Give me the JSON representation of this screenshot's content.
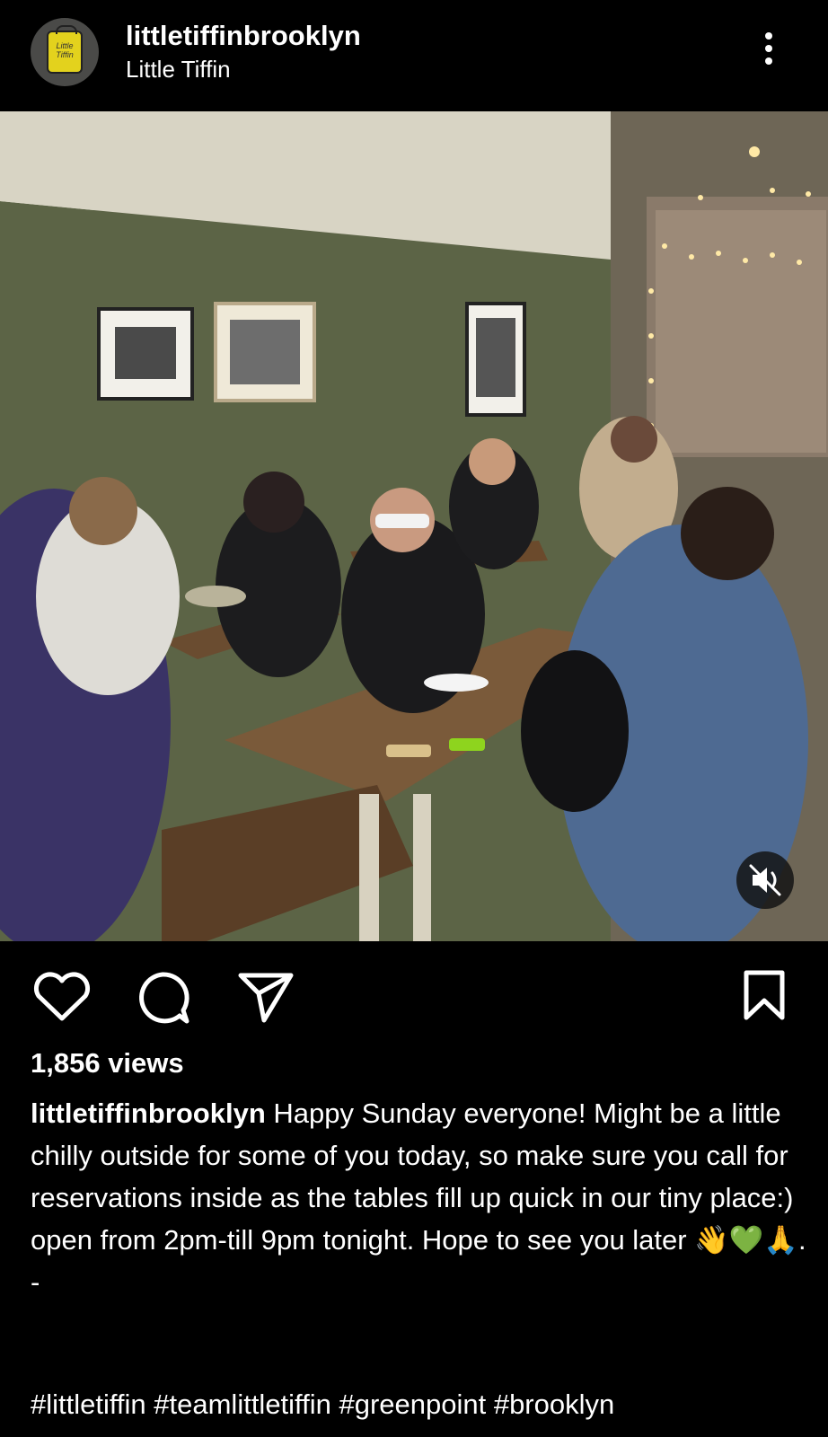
{
  "header": {
    "username": "littletiffinbrooklyn",
    "display_name": "Little Tiffin",
    "avatar_text": "Little Tiffin",
    "more_icon": "more-vertical-icon"
  },
  "media": {
    "type": "video",
    "mute_icon": "volume-muted-icon"
  },
  "actions": {
    "like_icon": "heart-icon",
    "comment_icon": "comment-icon",
    "share_icon": "send-icon",
    "save_icon": "bookmark-icon"
  },
  "post": {
    "views": "1,856 views",
    "caption_user": "littletiffinbrooklyn",
    "caption_text": "Happy Sunday everyone! Might be a little chilly outside for some of you today, so make sure you call for reservations inside as the tables fill up quick in our tiny place:) open from 2pm-till 9pm tonight.  Hope to see you later 👋💚🙏.",
    "caption_dash": "-",
    "hashtags": "#littletiffin #teamlittletiffin #greenpoint #brooklyn"
  }
}
